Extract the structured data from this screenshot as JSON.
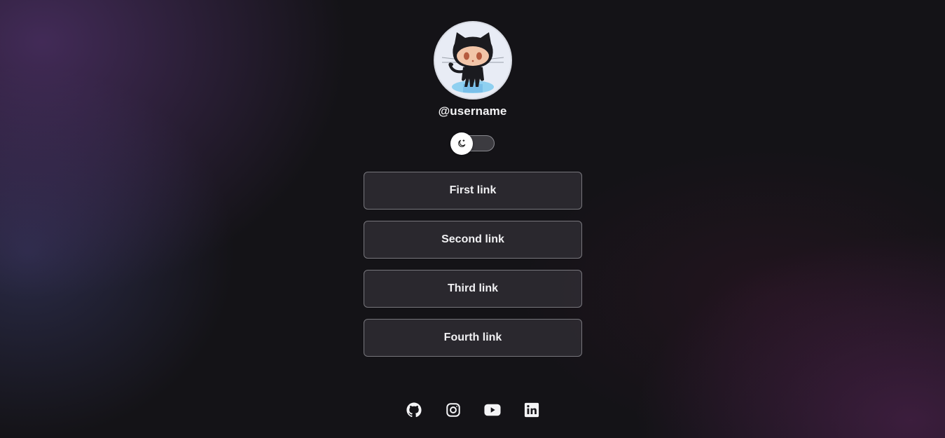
{
  "profile": {
    "username": "@username",
    "avatar_icon": "octocat-avatar"
  },
  "theme_toggle": {
    "icon": "moon-icon",
    "state": "dark"
  },
  "links": [
    {
      "label": "First link"
    },
    {
      "label": "Second link"
    },
    {
      "label": "Third link"
    },
    {
      "label": "Fourth link"
    }
  ],
  "socials": [
    {
      "icon": "github-icon"
    },
    {
      "icon": "instagram-icon"
    },
    {
      "icon": "youtube-icon"
    },
    {
      "icon": "linkedin-icon"
    }
  ],
  "colors": {
    "background": "#141317",
    "accent_purple": "#683e8c",
    "button_border": "#77767c",
    "text": "#f2f2f4"
  }
}
